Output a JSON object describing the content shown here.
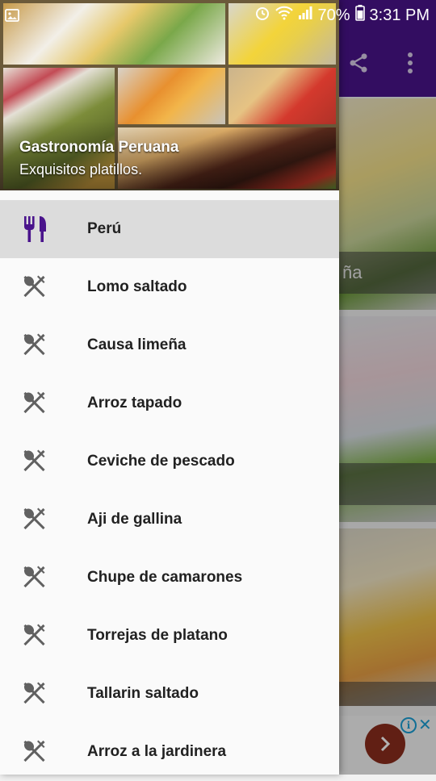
{
  "status_bar": {
    "battery": "70%",
    "time": "3:31 PM"
  },
  "drawer": {
    "header": {
      "title": "Gastronomía Peruana",
      "subtitle": "Exquisitos platillos."
    },
    "items": [
      {
        "label": "Perú",
        "icon": "fork-knife-icon",
        "active": true
      },
      {
        "label": "Lomo saltado",
        "icon": "spoon-fork-icon"
      },
      {
        "label": "Causa limeña",
        "icon": "spoon-fork-icon"
      },
      {
        "label": "Arroz tapado",
        "icon": "spoon-fork-icon"
      },
      {
        "label": "Ceviche de pescado",
        "icon": "spoon-fork-icon"
      },
      {
        "label": "Aji de gallina",
        "icon": "spoon-fork-icon"
      },
      {
        "label": "Chupe de camarones",
        "icon": "spoon-fork-icon"
      },
      {
        "label": "Torrejas de platano",
        "icon": "spoon-fork-icon"
      },
      {
        "label": "Tallarin saltado",
        "icon": "spoon-fork-icon"
      },
      {
        "label": "Arroz a la jardinera",
        "icon": "spoon-fork-icon"
      }
    ]
  },
  "background": {
    "toolbar_color": "#4a148c",
    "card_captions": [
      "ña",
      "",
      ""
    ]
  },
  "colors": {
    "accent": "#4a148c",
    "active_item_bg": "#dcdcdc"
  }
}
